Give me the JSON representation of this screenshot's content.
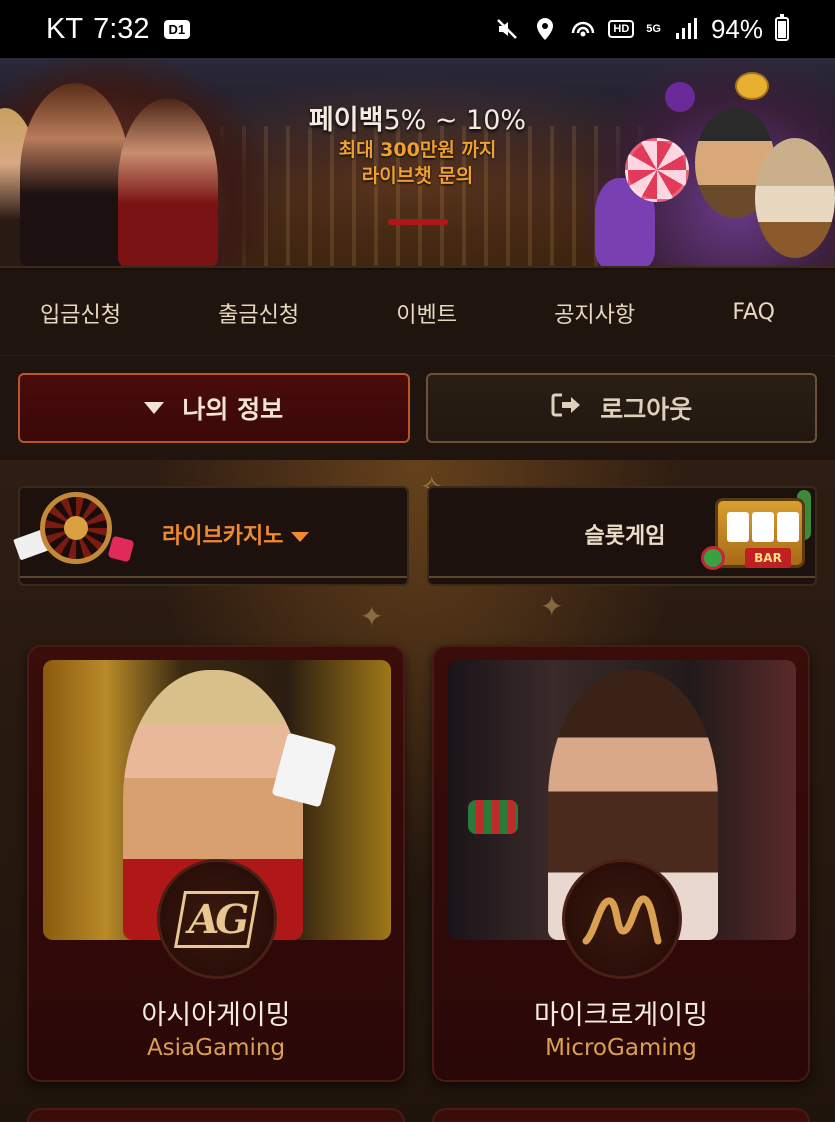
{
  "status_bar": {
    "carrier": "KT",
    "time": "7:32",
    "carrier_badge": "D1",
    "hd_label": "HD",
    "network": "5G",
    "battery": "94%",
    "battery_level": 0.94
  },
  "banner": {
    "title_bold": "페이백",
    "title_rest": "5% ~ 10%",
    "line1": "최대 300만원 까지",
    "line2": "라이브챗 문의"
  },
  "menu": {
    "items": [
      {
        "label": "입금신청"
      },
      {
        "label": "출금신청"
      },
      {
        "label": "이벤트"
      },
      {
        "label": "공지사항"
      },
      {
        "label": "FAQ"
      }
    ]
  },
  "user": {
    "my_info_label": "나의 정보",
    "logout_label": "로그아웃"
  },
  "categories": {
    "live_casino_label": "라이브카지노",
    "slot_label": "슬롯게임"
  },
  "games": [
    {
      "name_ko": "아시아게이밍",
      "name_en": "AsiaGaming",
      "logo_text": "AG"
    },
    {
      "name_ko": "마이크로게이밍",
      "name_en": "MicroGaming",
      "logo_text": ""
    }
  ],
  "colors": {
    "accent_orange": "#f08a30",
    "gold": "#d8a050",
    "dark_red": "#3a0c0a",
    "background": "#1f140e"
  }
}
